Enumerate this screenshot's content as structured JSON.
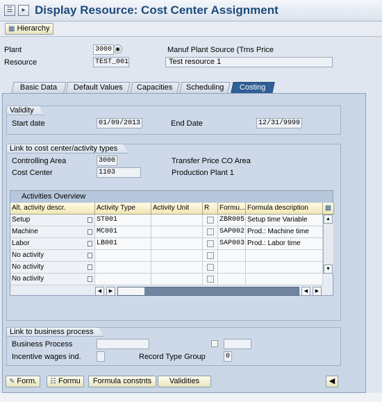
{
  "window": {
    "title": "Display Resource: Cost Center Assignment"
  },
  "toolbar": {
    "hierarchy_label": "Hierarchy"
  },
  "header": {
    "plant_label": "Plant",
    "plant_value": "3000",
    "plant_desc": "Manuf Plant Source (Trns Price",
    "resource_label": "Resource",
    "resource_value": "TEST_001",
    "resource_desc": "Test resource 1"
  },
  "tabs": [
    {
      "label": "Basic Data"
    },
    {
      "label": "Default Values"
    },
    {
      "label": "Capacities"
    },
    {
      "label": "Scheduling"
    },
    {
      "label": "Costing"
    }
  ],
  "validity": {
    "title": "Validity",
    "start_label": "Start date",
    "start_value": "01/09/2013",
    "end_label": "End Date",
    "end_value": "12/31/9999"
  },
  "link_cc": {
    "title": "Link to cost center/activity types",
    "co_area_label": "Controlling Area",
    "co_area_value": "3000",
    "co_area_desc": "Transfer Price CO Area",
    "cost_center_label": "Cost Center",
    "cost_center_value": "1103",
    "cost_center_desc": "Production Plant 1"
  },
  "activities": {
    "title": "Activities Overview",
    "columns": [
      "Alt. activity descr.",
      "Activity Type",
      "Activity Unit",
      "R",
      "Formu...",
      "Formula description"
    ],
    "rows": [
      {
        "descr": "Setup",
        "type": "ST001",
        "unit": "",
        "formula": "ZBR005",
        "fdesc": "Setup time Variable"
      },
      {
        "descr": "Machine",
        "type": "MC001",
        "unit": "",
        "formula": "SAP002",
        "fdesc": "Prod.: Machine time"
      },
      {
        "descr": "Labor",
        "type": "LB001",
        "unit": "",
        "formula": "SAP003",
        "fdesc": "Prod.: Labor time"
      },
      {
        "descr": "No activity",
        "type": "",
        "unit": "",
        "formula": "",
        "fdesc": ""
      },
      {
        "descr": "No activity",
        "type": "",
        "unit": "",
        "formula": "",
        "fdesc": ""
      },
      {
        "descr": "No activity",
        "type": "",
        "unit": "",
        "formula": "",
        "fdesc": ""
      }
    ]
  },
  "business": {
    "title": "Link to business process",
    "process_label": "Business Process",
    "incentive_label": "Incentive wages ind.",
    "record_label": "Record Type Group",
    "record_value": "0"
  },
  "footer": {
    "form1": "Form.",
    "form2": "Formu",
    "formula_constnts": "Formula constnts",
    "validities": "Validities"
  }
}
